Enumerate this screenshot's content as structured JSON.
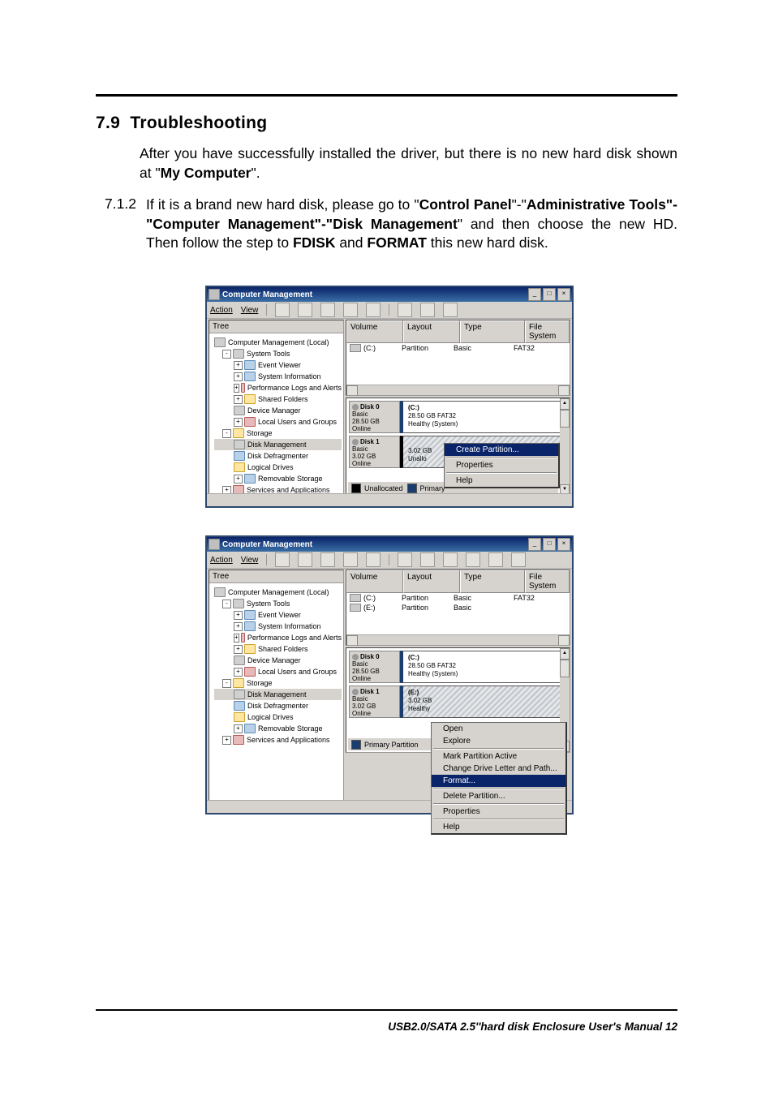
{
  "heading_num": "7.9",
  "heading_text": "Troubleshooting",
  "intro_pre": "After you have successfully installed the driver, but there is no new hard disk shown at \"",
  "intro_bold": "My Computer",
  "intro_post": "\".",
  "step_num": "7.1.2",
  "step_body_parts": {
    "p0": "If it is a brand new hard disk, please go to \"",
    "b0": "Control Panel",
    "p1": "\"-\"",
    "b1": "Administrative Tools\"-\"Computer Management\"-\"Disk Management",
    "p2": "\" and then choose the new HD. Then follow the step to ",
    "b2": "FDISK",
    "p3": " and ",
    "b3": "FORMAT",
    "p4": " this new hard disk."
  },
  "window": {
    "title": "Computer Management",
    "menus": {
      "action": "Action",
      "view": "View"
    },
    "tree_header": "Tree",
    "tree": {
      "root": "Computer Management (Local)",
      "sys_tools": "System Tools",
      "event_viewer": "Event Viewer",
      "sys_info": "System Information",
      "perf": "Performance Logs and Alerts",
      "shared": "Shared Folders",
      "devmgr": "Device Manager",
      "users": "Local Users and Groups",
      "storage": "Storage",
      "diskmgmt": "Disk Management",
      "defrag": "Disk Defragmenter",
      "logical": "Logical Drives",
      "removable": "Removable Storage",
      "services": "Services and Applications"
    },
    "cols": {
      "volume": "Volume",
      "layout": "Layout",
      "type": "Type",
      "fs": "File System"
    },
    "vol_rows": {
      "c_name": "(C:)",
      "e_name": "(E:)",
      "layout": "Partition",
      "type": "Basic",
      "fs": "FAT32"
    },
    "disks": {
      "disk0": "Disk 0",
      "disk1": "Disk 1",
      "basic": "Basic",
      "online": "Online",
      "size0": "28.50 GB",
      "size1": "3.02 GB",
      "part_c": "(C:)",
      "part_c_line": "28.50 GB FAT32",
      "part_c_status": "Healthy (System)",
      "part_e": "(E:)",
      "part_e_size": "3.02 GB",
      "part_e_status": "Healthy",
      "unallo": "Unallo"
    },
    "legend": {
      "unallocated": "Unallocated",
      "primary_cap": "Primary",
      "primary": "Primary Partition"
    },
    "ctx1": {
      "create": "Create Partition...",
      "props": "Properties",
      "help": "Help"
    },
    "ctx2": {
      "open": "Open",
      "explore": "Explore",
      "mark": "Mark Partition Active",
      "change": "Change Drive Letter and Path...",
      "format": "Format...",
      "delete": "Delete Partition...",
      "props": "Properties",
      "help": "Help"
    }
  },
  "footer": "USB2.0/SATA 2.5''hard disk Enclosure User's Manual 12"
}
